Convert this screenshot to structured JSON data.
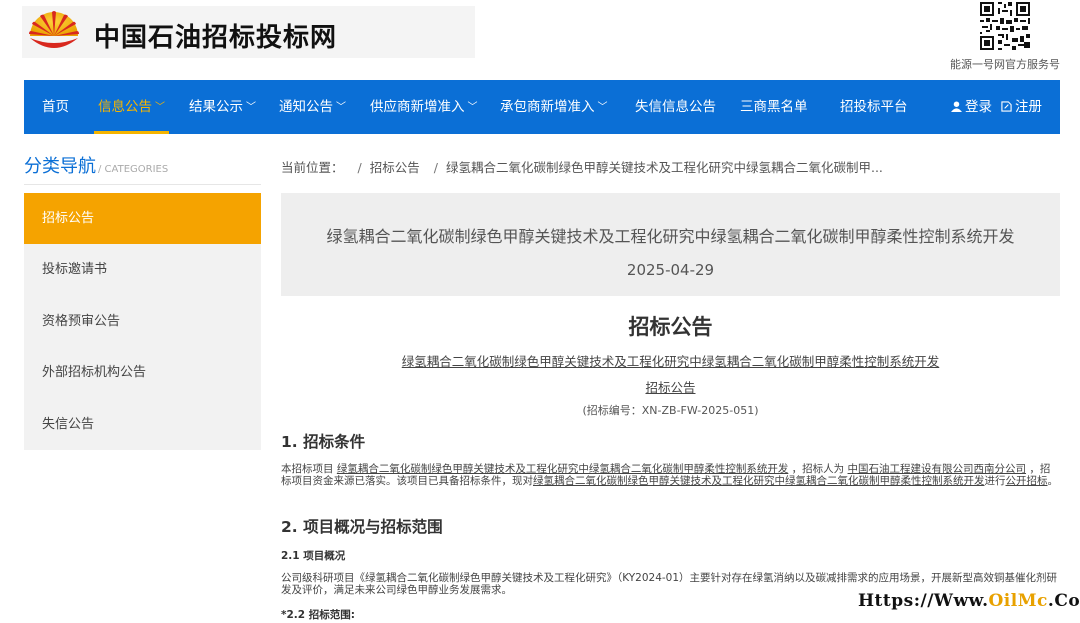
{
  "site": {
    "name": "中国石油招标投标网",
    "qr_caption": "能源一号网官方服务号"
  },
  "nav": {
    "items": [
      {
        "label": "首页"
      },
      {
        "label": "信息公告",
        "caret": "﹀"
      },
      {
        "label": "结果公示",
        "caret": "﹀"
      },
      {
        "label": "通知公告",
        "caret": "﹀"
      },
      {
        "label": "供应商新增准入",
        "caret": "﹀"
      },
      {
        "label": "承包商新增准入",
        "caret": "﹀"
      },
      {
        "label": "失信信息公告"
      },
      {
        "label": "三商黑名单"
      },
      {
        "label": "招投标平台"
      }
    ],
    "login": "登录",
    "register": "注册"
  },
  "sidebar": {
    "title": "分类导航",
    "title_en": "/ CATEGORIES",
    "items": [
      {
        "label": "招标公告"
      },
      {
        "label": "投标邀请书"
      },
      {
        "label": "资格预审公告"
      },
      {
        "label": "外部招标机构公告"
      },
      {
        "label": "失信公告"
      }
    ]
  },
  "breadcrumb": {
    "prefix": "当前位置：",
    "sep": "/",
    "category": "招标公告",
    "current": "绿氢耦合二氧化碳制绿色甲醇关键技术及工程化研究中绿氢耦合二氧化碳制甲..."
  },
  "article": {
    "title": "绿氢耦合二氧化碳制绿色甲醇关键技术及工程化研究中绿氢耦合二氧化碳制甲醇柔性控制系统开发",
    "date": "2025-04-29",
    "heading": "招标公告",
    "sub_title": "绿氢耦合二氧化碳制绿色甲醇关键技术及工程化研究中绿氢耦合二氧化碳制甲醇柔性控制系统开发",
    "sub_title2": "招标公告",
    "code": "(招标编号：XN-ZB-FW-2025-051)",
    "sec1": "1. 招标条件",
    "sec1_p": {
      "t1": "本招标项目 ",
      "u1": "绿氢耦合二氧化碳制绿色甲醇关键技术及工程化研究中绿氢耦合二氧化碳制甲醇柔性控制系统开发",
      "t2": " ，招标人为 ",
      "u2": "中国石油工程建设有限公司西南分公司",
      "t3": " ，招标项目资金来源已落实。该项目已具备招标条件，现对",
      "u3": "绿氢耦合二氧化碳制绿色甲醇关键技术及工程化研究中绿氢耦合二氧化碳制甲醇柔性控制系统开发",
      "t4": "进行",
      "u4": "公开招标",
      "t5": "。"
    },
    "sec2": "2. 项目概况与招标范围",
    "sec2_1": "2.1 项目概况",
    "sec2_1_p": "公司级科研项目《绿氢耦合二氧化碳制绿色甲醇关键技术及工程化研究》（KY2024-01）主要针对存在绿氢消纳以及碳减排需求的应用场景，开展新型高效铜基催化剂研发及评价，满足未来公司绿色甲醇业务发展需求。",
    "sec2_2": "*2.2 招标范围:"
  },
  "watermark": {
    "pre": "Https://Www.",
    "hl": "OilMc",
    "post": ".Com"
  },
  "colors": {
    "nav_bg": "#0b6fd6",
    "accent": "#f5a300"
  }
}
